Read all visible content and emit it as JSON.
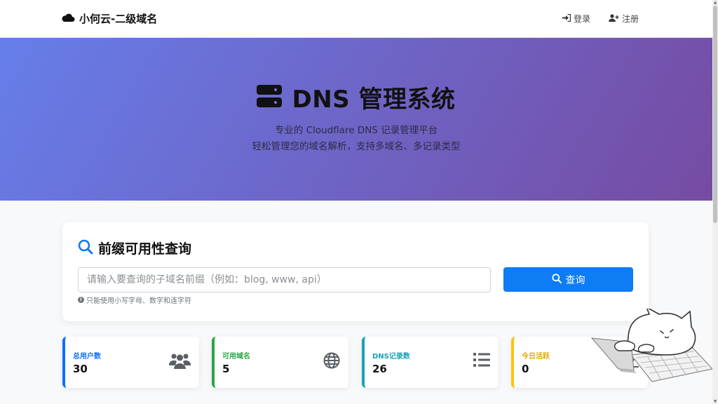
{
  "navbar": {
    "brand": "小何云-二级域名",
    "login": "登录",
    "register": "注册"
  },
  "hero": {
    "title": "DNS 管理系统",
    "subtitle_line1": "专业的 Cloudflare DNS 记录管理平台",
    "subtitle_line2": "轻松管理您的域名解析，支持多域名、多记录类型"
  },
  "search": {
    "title": "前缀可用性查询",
    "placeholder": "请输入要查询的子域名前缀（例如：blog, www, api）",
    "button": "查询",
    "hint": "只能使用小写字母、数字和连字符"
  },
  "stats": [
    {
      "label": "总用户数",
      "value": "30",
      "icon": "users-icon",
      "color": "#0d6efd"
    },
    {
      "label": "可用域名",
      "value": "5",
      "icon": "globe-icon",
      "color": "#28a745"
    },
    {
      "label": "DNS记录数",
      "value": "26",
      "icon": "list-icon",
      "color": "#17a2b8"
    },
    {
      "label": "今日活跃",
      "value": "0",
      "icon": "chart-line-icon",
      "color": "#ffc107"
    }
  ],
  "colors": {
    "primary": "#0d7cf5",
    "hero_gradient_start": "#667eea",
    "hero_gradient_end": "#764ba2"
  }
}
